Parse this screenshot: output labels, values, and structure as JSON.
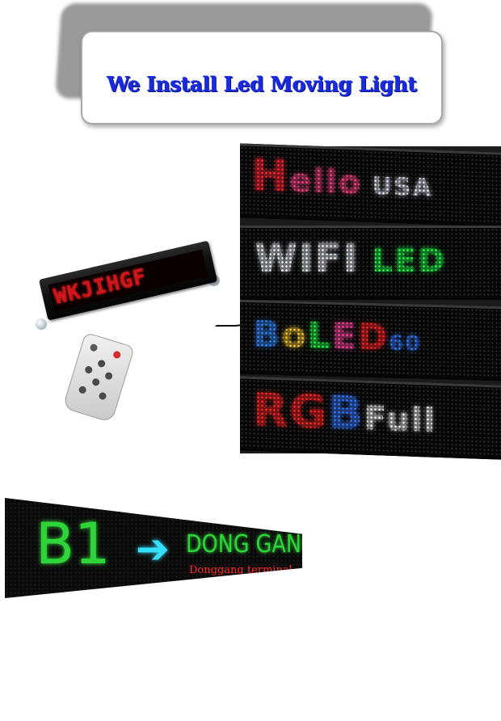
{
  "title": {
    "text": "We Install Led Moving Light",
    "color": "#1a2bdc"
  },
  "car_sign": {
    "text": "WKJIHGF",
    "led_color": "#d0141b"
  },
  "led_panels": [
    {
      "parts": [
        {
          "text": "H",
          "color": "#ff2a3a"
        },
        {
          "text": "ello",
          "color": "#ff4a8a"
        },
        {
          "text": " USA",
          "color": "#f0f0ff"
        }
      ]
    },
    {
      "parts": [
        {
          "text": "WIFI",
          "color": "#f4f6ff"
        },
        {
          "text": " LED",
          "color": "#2aff50"
        }
      ]
    },
    {
      "parts": [
        {
          "text": "B",
          "color": "#3a8cff"
        },
        {
          "text": "o",
          "color": "#ffd23a"
        },
        {
          "text": "L",
          "color": "#2aff50"
        },
        {
          "text": "E",
          "color": "#ff4aa0"
        },
        {
          "text": "D",
          "color": "#ff2a2a"
        },
        {
          "text": "60",
          "color": "#3a7cff"
        }
      ]
    },
    {
      "parts": [
        {
          "text": "RG",
          "color": "#ff2a2a"
        },
        {
          "text": "B",
          "color": "#3a7cff"
        },
        {
          "text": "Full",
          "color": "#ffffff"
        }
      ]
    }
  ],
  "bottom_sign": {
    "code": "B1",
    "arrow": "➔",
    "destination": "DONG GANG",
    "subtitle": "Donggang terminal",
    "colors": {
      "green": "#2fd43a",
      "arrow": "#35e0ff",
      "subtitle": "#ff2a2a"
    }
  }
}
